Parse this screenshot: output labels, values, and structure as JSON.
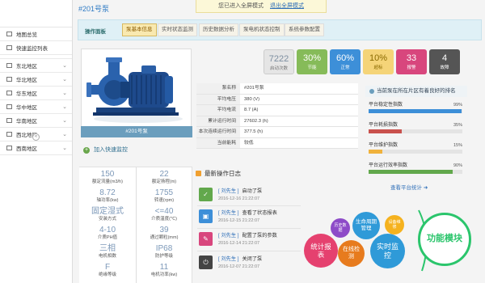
{
  "sidebar": {
    "items": [
      {
        "label": "地图总览",
        "has_chevron": false
      },
      {
        "label": "快速监控列表",
        "has_chevron": false
      },
      {
        "label": "东北地区",
        "has_chevron": true
      },
      {
        "label": "华北地区",
        "has_chevron": true
      },
      {
        "label": "华东地区",
        "has_chevron": true
      },
      {
        "label": "华中地区",
        "has_chevron": true
      },
      {
        "label": "华南地区",
        "has_chevron": true
      },
      {
        "label": "西北地区",
        "has_chevron": true
      },
      {
        "label": "西南地区",
        "has_chevron": true
      }
    ],
    "collapse_glyph": "«"
  },
  "header": {
    "title": "#201号泵",
    "banner_text": "您已进入全屏模式",
    "banner_exit": "退出全屏模式"
  },
  "op_panel": {
    "label": "操作面板",
    "tabs": [
      "泵基本信息",
      "实时状态监测",
      "历史数据分析",
      "泵电机状态控制",
      "系统参数配置"
    ]
  },
  "pump": {
    "name": "#201号泵",
    "add_monitor": "加入快速监控",
    "add_glyph": "+"
  },
  "specs": [
    {
      "value": "150",
      "label": "额定流量(m3/h)"
    },
    {
      "value": "22",
      "label": "额定扬程(m)"
    },
    {
      "value": "8.72",
      "label": "轴功率(kw)"
    },
    {
      "value": "1755",
      "label": "转速(rpm)"
    },
    {
      "value": "固定湿式",
      "label": "安装方式"
    },
    {
      "value": "<=40",
      "label": "介质温度(℃)"
    },
    {
      "value": "4-10",
      "label": "介质PH值"
    },
    {
      "value": "39",
      "label": "通过颗粒(mm)"
    },
    {
      "value": "三相",
      "label": "电机相数"
    },
    {
      "value": "IP68",
      "label": "防护等级"
    },
    {
      "value": "F",
      "label": "绝缘等级"
    },
    {
      "value": "11",
      "label": "电机功率(kw)"
    }
  ],
  "stats": [
    {
      "value": "7222",
      "label": "启动次数",
      "color": "#e5e5e5"
    },
    {
      "value": "30%",
      "label": "节能",
      "color": "#86bb59"
    },
    {
      "value": "60%",
      "label": "正常",
      "color": "#3d8fd8"
    },
    {
      "value": "10%",
      "label": "超标",
      "color": "#f5d478"
    },
    {
      "value": "33",
      "label": "报警",
      "color": "#d8467d"
    },
    {
      "value": "4",
      "label": "故障",
      "color": "#555555"
    }
  ],
  "info": [
    {
      "k": "泵名称",
      "v": "#201号泵"
    },
    {
      "k": "平均电压",
      "v": "380 (V)"
    },
    {
      "k": "平均电流",
      "v": "8.7 (A)"
    },
    {
      "k": "累计运行时间",
      "v": "27602.3 (h)"
    },
    {
      "k": "本次连续运行时间",
      "v": "377.5 (h)"
    },
    {
      "k": "当前能耗",
      "v": "较低"
    }
  ],
  "indicators": {
    "title": "当前泵在所在片区有着良好的排名",
    "items": [
      {
        "label": "平台稳定性指数",
        "percent": "99%",
        "value": 0.99,
        "color": "#3d8fd8"
      },
      {
        "label": "平台耗损指数",
        "percent": "35%",
        "value": 0.35,
        "color": "#c9514d"
      },
      {
        "label": "平台维护指数",
        "percent": "15%",
        "value": 0.15,
        "color": "#f0b23c"
      },
      {
        "label": "平台运行效率指数",
        "percent": "90%",
        "value": 0.9,
        "color": "#62a84c"
      }
    ]
  },
  "log": {
    "title": "最新操作日志",
    "more": "查看平台统计",
    "more_glyph": "➜",
    "items": [
      {
        "who": "[ 刘先生 ]",
        "action": "启动了泵",
        "time": "2016-12-16 21:22:07",
        "icon": "check-icon",
        "glyph": "✓",
        "color": "#62a84c"
      },
      {
        "who": "[ 刘先生 ]",
        "action": "查看了状态报表",
        "time": "2016-12-15 21:22:07",
        "icon": "image-icon",
        "glyph": "▣",
        "color": "#3d8fd8"
      },
      {
        "who": "[ 刘先生 ]",
        "action": "配置了泵的参数",
        "time": "2016-12-14 21:22:07",
        "icon": "edit-icon",
        "glyph": "✎",
        "color": "#d8467d"
      },
      {
        "who": "[ 刘先生 ]",
        "action": "关闭了泵",
        "time": "2016-12-07 21:22:07",
        "icon": "power-icon",
        "glyph": "⏻",
        "color": "#444444"
      }
    ]
  },
  "bubbles": [
    {
      "label": "功能模块",
      "color": "#2bc56c"
    },
    {
      "label": "生命周期管理",
      "color": "#2f9ad8"
    },
    {
      "label": "实时监控",
      "color": "#2f9ad8"
    },
    {
      "label": "统计报表",
      "color": "#e5416f"
    },
    {
      "label": "在线检测",
      "color": "#e77b1e"
    },
    {
      "label": "历史数据",
      "color": "#8d4bc8"
    },
    {
      "label": "设备维修",
      "color": "#f5b21f"
    }
  ]
}
